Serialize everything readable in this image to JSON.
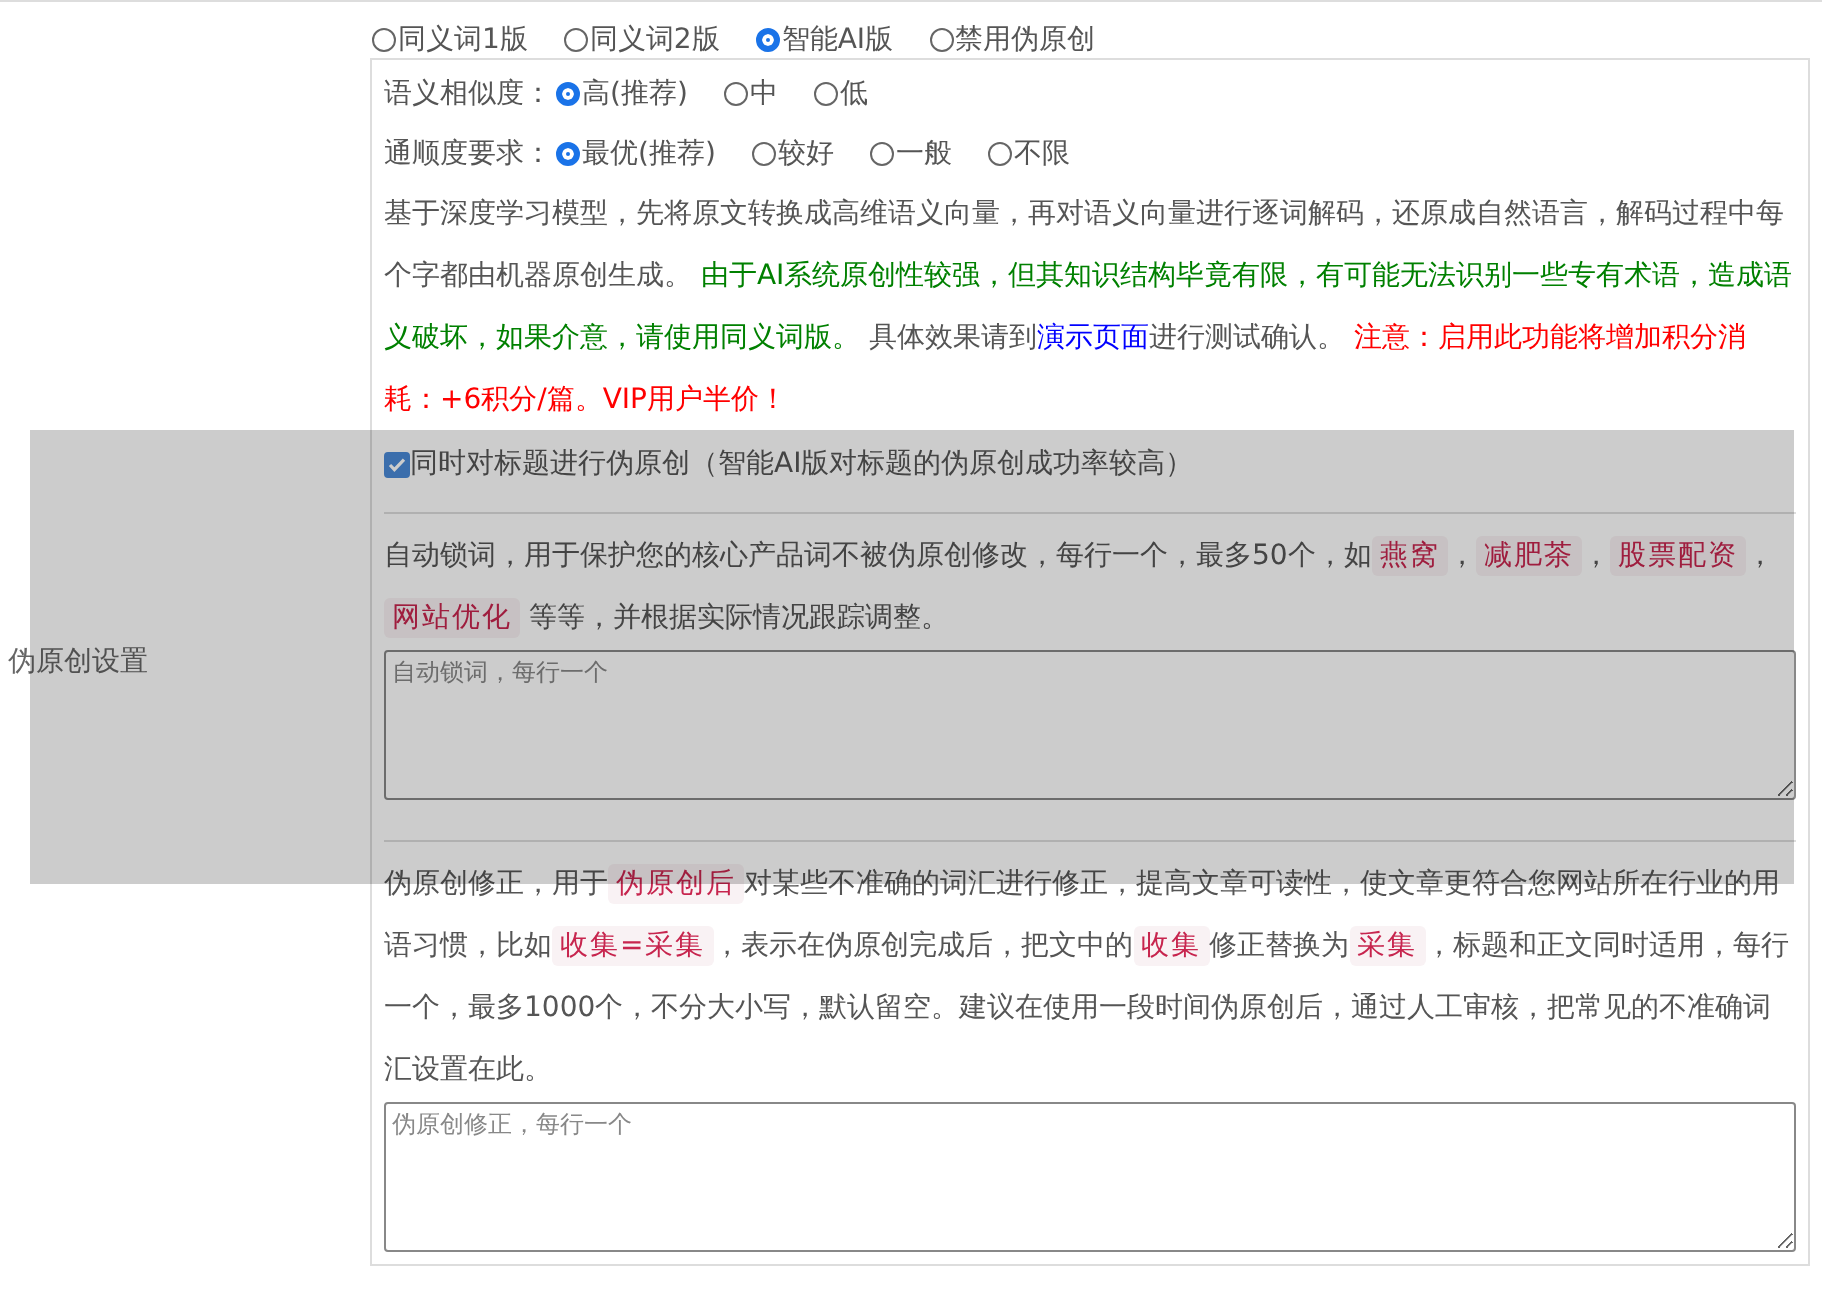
{
  "modes": [
    {
      "label": "同义词1版",
      "selected": false
    },
    {
      "label": "同义词2版",
      "selected": false
    },
    {
      "label": "智能AI版",
      "selected": true
    },
    {
      "label": "禁用伪原创",
      "selected": false
    }
  ],
  "section_label": "伪原创设置",
  "similarity": {
    "label": "语义相似度：",
    "options": [
      {
        "label": "高(推荐)",
        "selected": true
      },
      {
        "label": "中",
        "selected": false
      },
      {
        "label": "低",
        "selected": false
      }
    ]
  },
  "fluency": {
    "label": "通顺度要求：",
    "options": [
      {
        "label": "最优(推荐)",
        "selected": true
      },
      {
        "label": "较好",
        "selected": false
      },
      {
        "label": "一般",
        "selected": false
      },
      {
        "label": "不限",
        "selected": false
      }
    ]
  },
  "description": [
    {
      "kind": "text",
      "text": "基于深度学习模型，先将原文转换成高维语义向量，再对语义向量进行逐词解码，还原成自然语言，解码过程中每个字都由机器原创生成。 "
    },
    {
      "kind": "notice",
      "text": "由于AI系统原创性较强，但其知识结构毕竟有限，有可能无法识别一些专有术语，造成语义破坏，如果介意，请使用同义词版。"
    },
    {
      "kind": "text",
      "text": " 具体效果请到"
    },
    {
      "kind": "link",
      "text": "演示页面"
    },
    {
      "kind": "text",
      "text": "进行测试确认。 "
    },
    {
      "kind": "alert",
      "text": "注意：启用此功能将增加积分消耗：+6积分/篇。VIP用户半价！"
    }
  ],
  "title_rewrite": {
    "label": "同时对标题进行伪原创（智能AI版对标题的伪原创成功率较高）",
    "checked": true
  },
  "lock_words": {
    "description": [
      {
        "kind": "text",
        "text": "自动锁词，用于保护您的核心产品词不被伪原创修改，每行一个，最多50个，如"
      },
      {
        "kind": "code",
        "text": "燕窝"
      },
      {
        "kind": "text",
        "text": "，"
      },
      {
        "kind": "code",
        "text": "减肥茶"
      },
      {
        "kind": "text",
        "text": "，"
      },
      {
        "kind": "code",
        "text": "股票配资"
      },
      {
        "kind": "text",
        "text": "，"
      },
      {
        "kind": "code",
        "text": "网站优化"
      },
      {
        "kind": "text",
        "text": " 等等，并根据实际情况跟踪调整。"
      }
    ],
    "placeholder": "自动锁词，每行一个"
  },
  "correction": {
    "description": [
      {
        "kind": "text",
        "text": "伪原创修正，用于"
      },
      {
        "kind": "code",
        "text": "伪原创后"
      },
      {
        "kind": "text",
        "text": "对某些不准确的词汇进行修正，提高文章可读性，使文章更符合您网站所在行业的用语习惯，比如"
      },
      {
        "kind": "code",
        "text": "收集=采集"
      },
      {
        "kind": "text",
        "text": "，表示在伪原创完成后，把文中的"
      },
      {
        "kind": "code",
        "text": "收集"
      },
      {
        "kind": "text",
        "text": "修正替换为"
      },
      {
        "kind": "code",
        "text": "采集"
      },
      {
        "kind": "text",
        "text": "，标题和正文同时适用，每行一个，最多1000个，不分大小写，默认留空。建议在使用一段时间伪原创后，通过人工审核，把常见的不准确词汇设置在此。"
      }
    ],
    "placeholder": "伪原创修正，每行一个"
  }
}
